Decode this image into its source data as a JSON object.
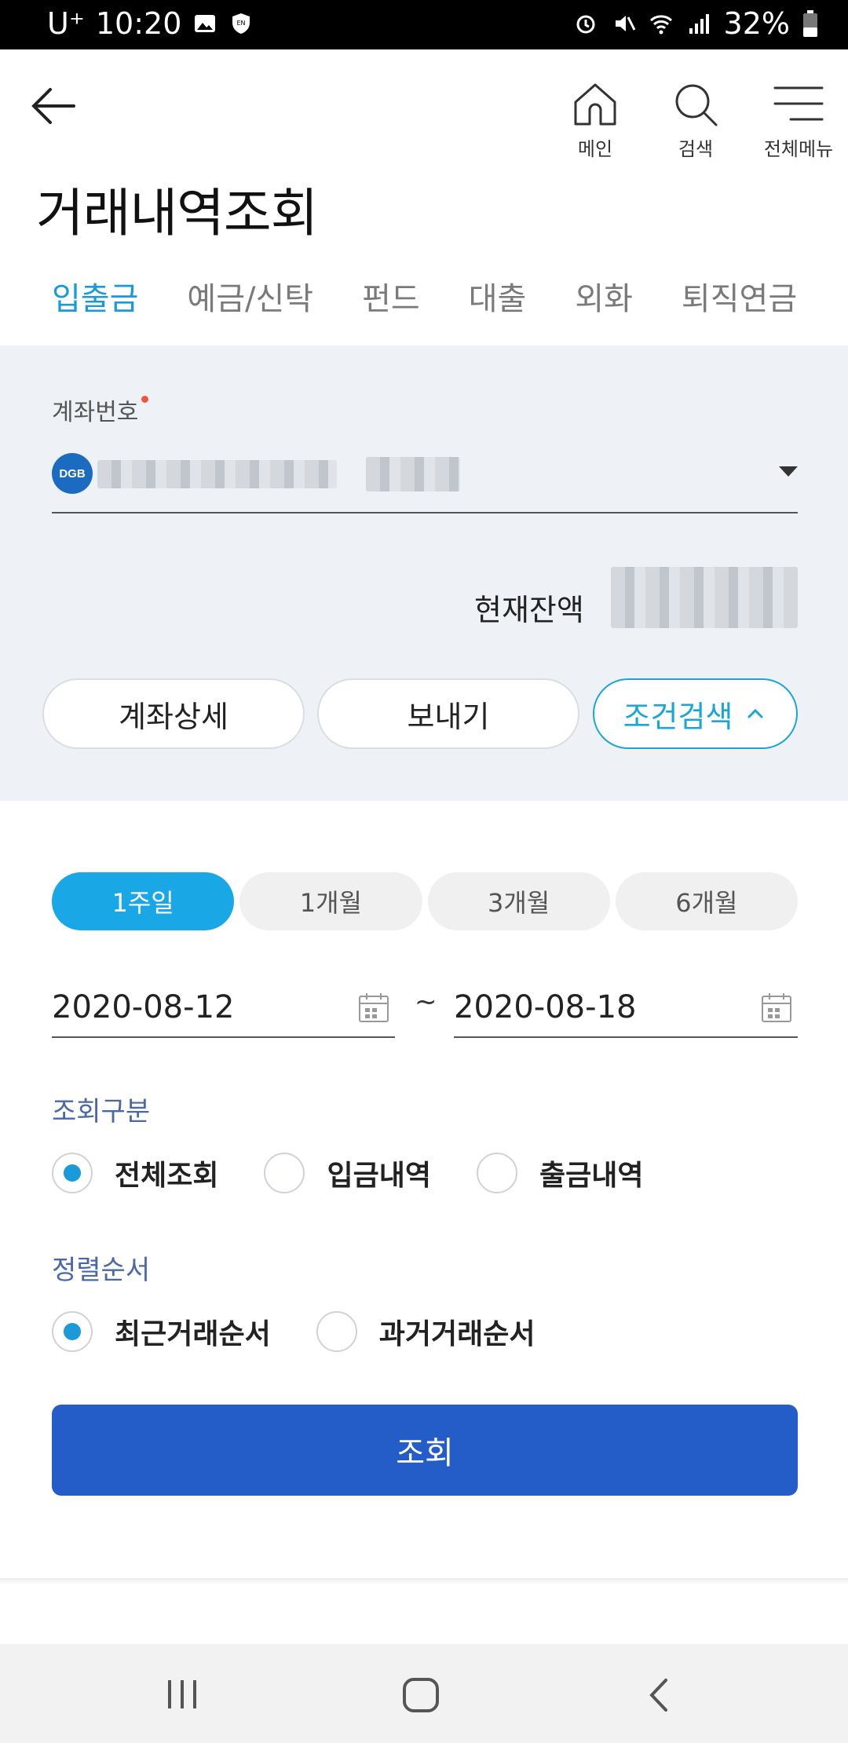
{
  "status_bar": {
    "carrier": "U⁺",
    "time": "10:20",
    "battery": "32%",
    "icons": [
      "image-icon",
      "vpn-shield-icon",
      "alarm-icon",
      "mute-icon",
      "wifi-icon",
      "signal-icon",
      "battery-icon"
    ]
  },
  "header": {
    "back_icon": "arrow-left-icon",
    "home_label": "메인",
    "search_label": "검색",
    "menu_label": "전체메뉴"
  },
  "page_title": "거래내역조회",
  "tabs": [
    {
      "label": "입출금",
      "active": true
    },
    {
      "label": "예금/신탁",
      "active": false
    },
    {
      "label": "펀드",
      "active": false
    },
    {
      "label": "대출",
      "active": false
    },
    {
      "label": "외화",
      "active": false
    },
    {
      "label": "퇴직연금",
      "active": false
    }
  ],
  "account": {
    "label": "계좌번호",
    "bank_logo": "DGB",
    "balance_label": "현재잔액"
  },
  "actions": {
    "detail": "계좌상세",
    "send": "보내기",
    "filter": "조건검색"
  },
  "period": {
    "options": [
      "1주일",
      "1개월",
      "3개월",
      "6개월"
    ],
    "selected": "1주일"
  },
  "dates": {
    "start": "2020-08-12",
    "separator": "~",
    "end": "2020-08-18"
  },
  "inquiry_type": {
    "label": "조회구분",
    "options": [
      "전체조회",
      "입금내역",
      "출금내역"
    ],
    "selected": "전체조회"
  },
  "sort_order": {
    "label": "정렬순서",
    "options": [
      "최근거래순서",
      "과거거래순서"
    ],
    "selected": "최근거래순서"
  },
  "submit_label": "조회",
  "colors": {
    "accent": "#1a9ad8",
    "primary_button": "#245dc8",
    "panel_bg": "#eef2f7",
    "section_label": "#4a68a8"
  }
}
